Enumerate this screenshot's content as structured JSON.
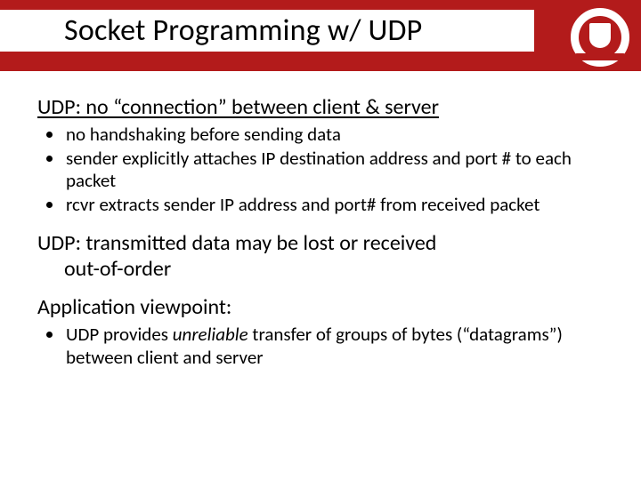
{
  "colors": {
    "brand": "#b31b1b"
  },
  "title": "Socket Programming w/ UDP",
  "seal": {
    "name": "cornell-seal"
  },
  "sections": {
    "s1": {
      "heading": "UDP: no “connection” between client & server",
      "bullets": [
        "no handshaking before sending data",
        "sender explicitly attaches IP destination address and port # to each packet",
        "rcvr extracts sender IP address and port# from received packet"
      ]
    },
    "s2": {
      "heading": "UDP: transmitted data may be lost or received",
      "sub": "out-of-order"
    },
    "s3": {
      "heading": "Application viewpoint:"
    },
    "s4": {
      "bullet_prefix": "UDP provides ",
      "bullet_em": "unreliable",
      "bullet_suffix": " transfer  of groups of bytes (“datagrams”)  between client and server"
    }
  }
}
